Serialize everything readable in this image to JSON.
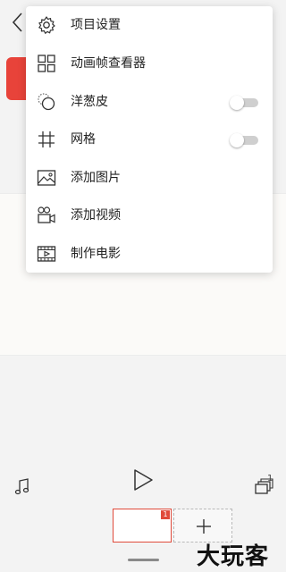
{
  "menu": {
    "items": [
      {
        "label": "项目设置",
        "icon": "gear-icon"
      },
      {
        "label": "动画帧查看器",
        "icon": "grid-four-icon"
      },
      {
        "label": "洋葱皮",
        "icon": "onion-skin-icon",
        "toggle": false
      },
      {
        "label": "网格",
        "icon": "hash-grid-icon",
        "toggle": false
      },
      {
        "label": "添加图片",
        "icon": "image-icon"
      },
      {
        "label": "添加视频",
        "icon": "video-camera-icon"
      },
      {
        "label": "制作电影",
        "icon": "film-icon"
      }
    ]
  },
  "timeline": {
    "frame_badge": "1",
    "layers_count": "1"
  },
  "watermark": "大玩客",
  "colors": {
    "accent_red": "#e8433a"
  }
}
